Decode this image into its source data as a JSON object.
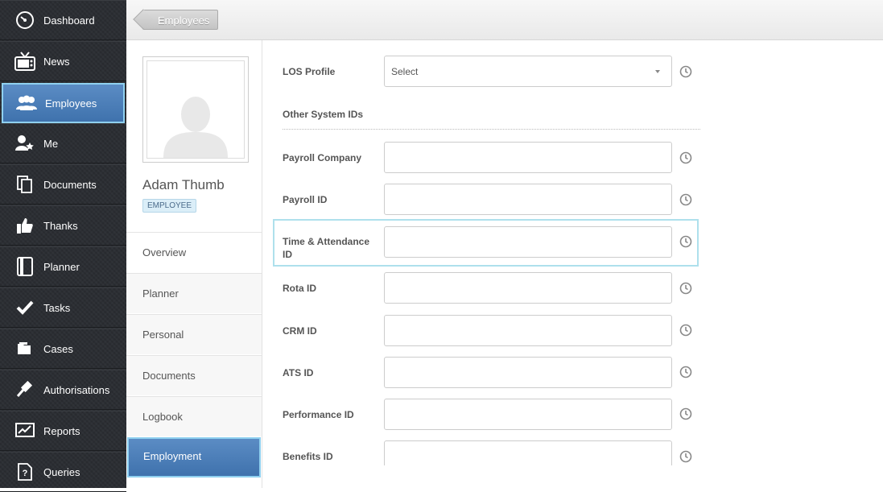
{
  "sidebar": {
    "items": [
      {
        "label": "Dashboard",
        "icon": "dashboard-icon"
      },
      {
        "label": "News",
        "icon": "tv-icon"
      },
      {
        "label": "Employees",
        "icon": "users-icon",
        "active": true
      },
      {
        "label": "Me",
        "icon": "user-star-icon"
      },
      {
        "label": "Documents",
        "icon": "documents-icon"
      },
      {
        "label": "Thanks",
        "icon": "thumbs-up-icon"
      },
      {
        "label": "Planner",
        "icon": "planner-icon"
      },
      {
        "label": "Tasks",
        "icon": "checkmark-icon"
      },
      {
        "label": "Cases",
        "icon": "folder-icon"
      },
      {
        "label": "Authorisations",
        "icon": "gavel-icon"
      },
      {
        "label": "Reports",
        "icon": "chart-icon"
      },
      {
        "label": "Queries",
        "icon": "question-icon"
      }
    ]
  },
  "breadcrumb": {
    "label": "Employees"
  },
  "profile": {
    "name": "Adam Thumb",
    "badge": "EMPLOYEE",
    "menu": [
      {
        "label": "Overview"
      },
      {
        "label": "Planner"
      },
      {
        "label": "Personal"
      },
      {
        "label": "Documents"
      },
      {
        "label": "Logbook"
      },
      {
        "label": "Employment",
        "active": true
      }
    ]
  },
  "form": {
    "los_profile": {
      "label": "LOS Profile",
      "value": "Select"
    },
    "section_title": "Other System IDs",
    "fields": [
      {
        "label": "Payroll Company",
        "value": ""
      },
      {
        "label": "Payroll ID",
        "value": ""
      },
      {
        "label": "Time & Attendance ID",
        "value": ""
      },
      {
        "label": "Rota ID",
        "value": ""
      },
      {
        "label": "CRM ID",
        "value": ""
      },
      {
        "label": "ATS ID",
        "value": ""
      },
      {
        "label": "Performance ID",
        "value": ""
      },
      {
        "label": "Benefits ID",
        "value": ""
      }
    ]
  }
}
